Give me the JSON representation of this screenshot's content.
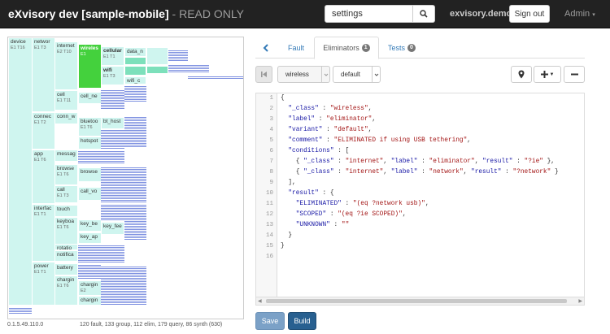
{
  "header": {
    "title_prefix": "eXvisory dev [sample-mobile]",
    "title_suffix": " - READ ONLY",
    "search_value": "settings",
    "site": "exvisory.demo",
    "signout_label": "Sign out",
    "admin_label": "Admin"
  },
  "treemap": {
    "device": {
      "name": "device",
      "stats": "E1 T16"
    },
    "network": {
      "name": "networ",
      "stats": "E1 T3"
    },
    "internet": {
      "name": "internet",
      "stats": "E2 T10"
    },
    "wireless": {
      "name": "wireles",
      "stats": "E1"
    },
    "cellular": {
      "name": "cellular",
      "stats": "E1 T1"
    },
    "data": {
      "name": "data_n"
    },
    "wifi": {
      "name": "wifi",
      "stats": "E1 T3"
    },
    "wifi2": {
      "name": "wifi_c"
    },
    "cell": {
      "name": "cell",
      "stats": "E1 T11"
    },
    "cell_ne": {
      "name": "cell_ne"
    },
    "connec": {
      "name": "connec",
      "stats": "E1 T2"
    },
    "conn_w": {
      "name": "conn_w"
    },
    "bluetoo": {
      "name": "bluetoo",
      "stats": "E1 T6"
    },
    "bt_host": {
      "name": "bt_host"
    },
    "hotspot": {
      "name": "hotspot"
    },
    "app": {
      "name": "app",
      "stats": "E1 T6"
    },
    "messag": {
      "name": "messag"
    },
    "browse": {
      "name": "browse",
      "stats": "E1 T6"
    },
    "browse2": {
      "name": "browse"
    },
    "call": {
      "name": "call",
      "stats": "E1 T3"
    },
    "call_vo": {
      "name": "call_vo"
    },
    "interfac": {
      "name": "interfac",
      "stats": "E1 T1"
    },
    "touch": {
      "name": "touch"
    },
    "keyboa": {
      "name": "keyboa",
      "stats": "E1 T6"
    },
    "key_be": {
      "name": "key_be"
    },
    "key_ap": {
      "name": "key_ap"
    },
    "key_fee": {
      "name": "key_fee"
    },
    "rotation": {
      "name": "rotatio"
    },
    "notifica": {
      "name": "notifica"
    },
    "power": {
      "name": "power",
      "stats": "E1 T1"
    },
    "battery": {
      "name": "battery"
    },
    "chargin": {
      "name": "chargin",
      "stats": "E1 T6"
    },
    "chargin2": {
      "name": "chargin",
      "stats": "E2"
    },
    "chargin3": {
      "name": "chargin"
    }
  },
  "footer": {
    "version": "0.1.5.49.110.0",
    "stats": "120 fault, 133 group, 112 elim, 179 query, 86 synth (630)"
  },
  "tabs": [
    {
      "label": "Fault"
    },
    {
      "label": "Eliminators",
      "badge": "1"
    },
    {
      "label": "Tests",
      "badge": "0"
    }
  ],
  "toolbar": {
    "select1": "wireless",
    "select2": "default"
  },
  "editor": {
    "line_numbers": [
      "1",
      "2",
      "3",
      "4",
      "5",
      "6",
      "7",
      "8",
      "9",
      "10",
      "11",
      "12",
      "13",
      "14",
      "15",
      "16"
    ],
    "lines": [
      "{",
      "  \"_class\" : \"wireless\",",
      "  \"label\" : \"eliminator\",",
      "  \"variant\" : \"default\",",
      "  \"comment\" : \"ELIMINATED if using USB tethering\",",
      "  \"conditions\" : [",
      "    { \"_class\" : \"internet\", \"label\" : \"eliminator\", \"result\" : \"?ie\" },",
      "    { \"_class\" : \"internet\", \"label\" : \"network\", \"result\" : \"?network\" }",
      "  ],",
      "  \"result\" : {",
      "    \"ELIMINATED\" : \"(eq ?network usb)\",",
      "    \"SCOPED\" : \"(eq ?ie SCOPED)\",",
      "    \"UNKNOWN\" : \"\"",
      "  }",
      "}",
      ""
    ]
  },
  "actions": {
    "save": "Save",
    "build": "Build"
  }
}
